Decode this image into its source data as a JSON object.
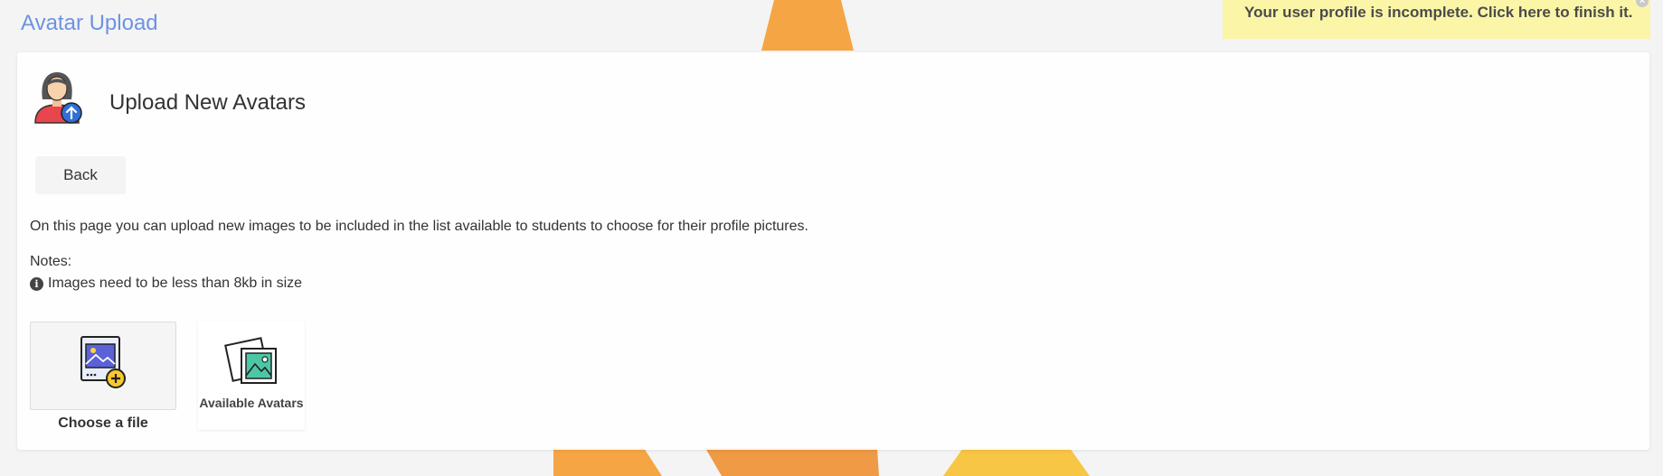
{
  "page": {
    "title": "Avatar Upload"
  },
  "notice": {
    "text": "Your user profile is incomplete. Click here to finish it.",
    "close_glyph": "×"
  },
  "card": {
    "title": "Upload New Avatars",
    "header_icon": "user-upload-icon",
    "back_label": "Back",
    "intro": "On this page you can upload new images to be included in the list available to students to choose for their profile pictures.",
    "notes_label": "Notes:",
    "notes": [
      {
        "icon": "info-icon",
        "glyph": "i",
        "text": "Images need to be less than 8kb in size"
      }
    ],
    "tiles": {
      "choose_file": {
        "label": "Choose a file",
        "icon": "add-image-icon"
      },
      "available_avatars": {
        "label": "Available Avatars",
        "icon": "image-gallery-icon"
      }
    }
  },
  "colors": {
    "title_blue": "#6d93e0",
    "notice_yellow": "#fbf5a8",
    "accent_orange": "#f5a13a",
    "accent_yellow": "#f7c645"
  }
}
